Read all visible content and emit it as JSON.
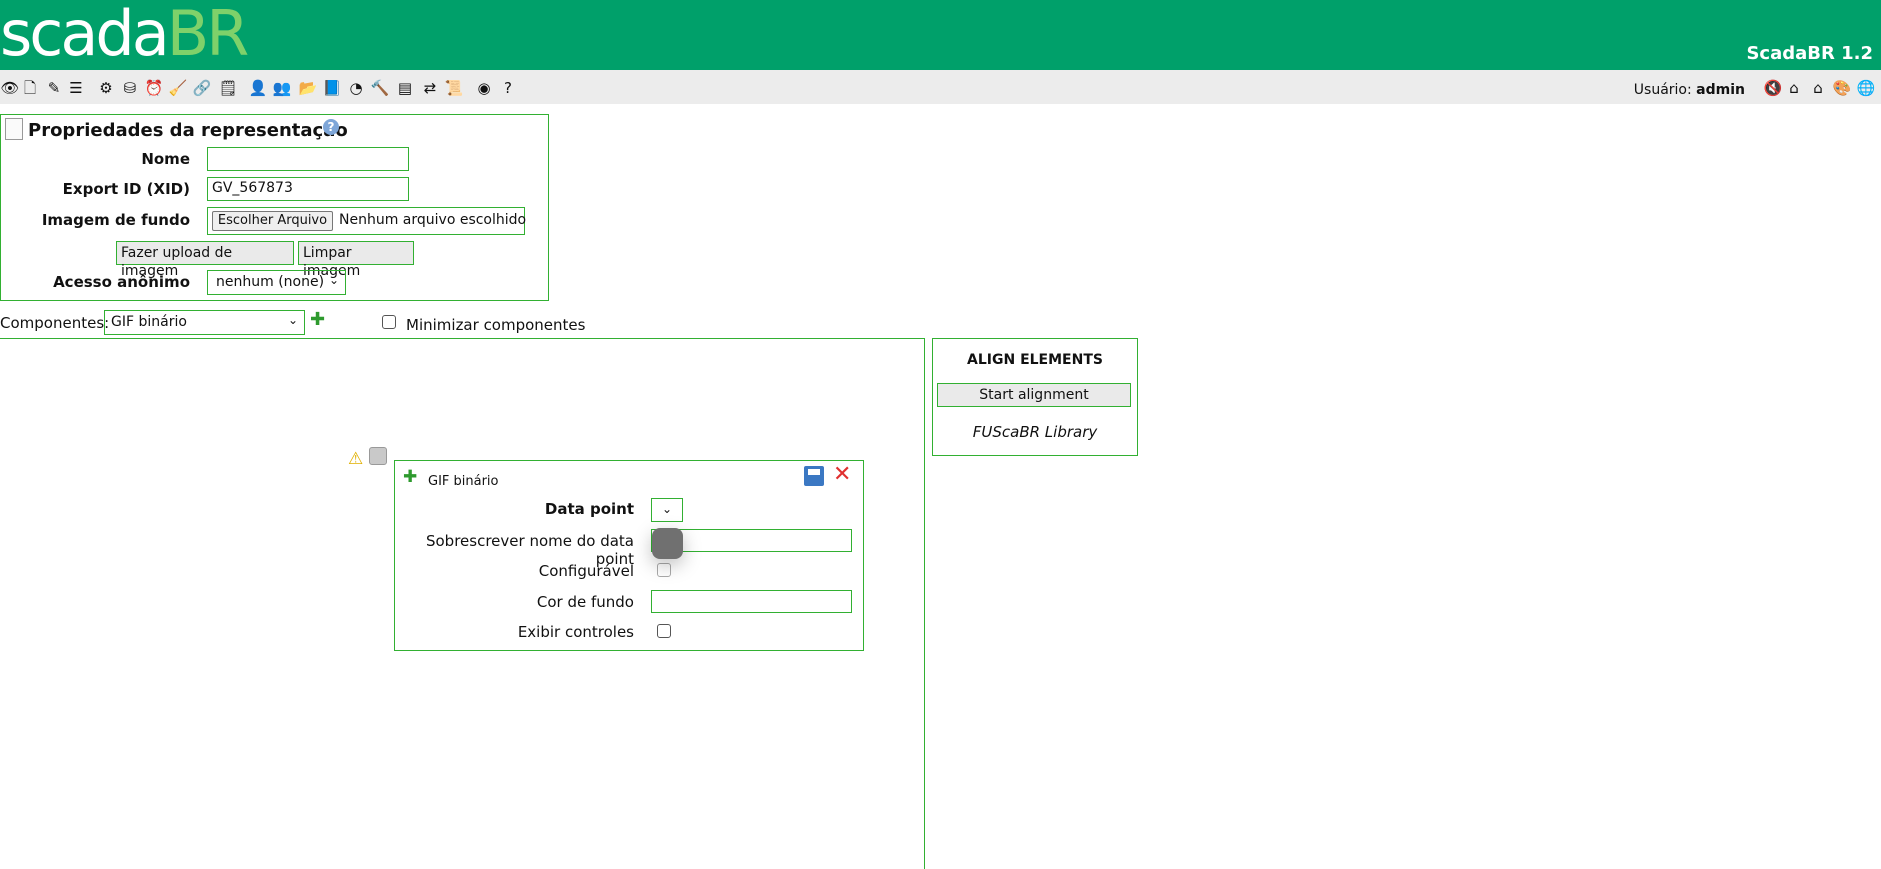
{
  "header": {
    "logo_main": "scada",
    "logo_accent": "BR",
    "version": "ScadaBR 1.2"
  },
  "toolbar": {
    "icons": [
      {
        "name": "eye-icon",
        "glyph": "👁"
      },
      {
        "name": "page-icon",
        "glyph": "🗋"
      },
      {
        "name": "notes-icon",
        "glyph": "✎"
      },
      {
        "name": "list-icon",
        "glyph": "☰"
      },
      {
        "name": "gear-icon",
        "glyph": "⚙"
      },
      {
        "name": "database-icon",
        "glyph": "⛁"
      },
      {
        "name": "clock-icon",
        "glyph": "⏰"
      },
      {
        "name": "broom-icon",
        "glyph": "🧹"
      },
      {
        "name": "link-icon",
        "glyph": "🔗"
      },
      {
        "name": "report-icon",
        "glyph": "🗒"
      },
      {
        "name": "user-icon",
        "glyph": "👤"
      },
      {
        "name": "users-icon",
        "glyph": "👥"
      },
      {
        "name": "folder-icon",
        "glyph": "📂"
      },
      {
        "name": "book-icon",
        "glyph": "📘"
      },
      {
        "name": "signal-icon",
        "glyph": "◔"
      },
      {
        "name": "tools-icon",
        "glyph": "🔨"
      },
      {
        "name": "window-icon",
        "glyph": "▤"
      },
      {
        "name": "import-export-icon",
        "glyph": "⇄"
      },
      {
        "name": "script-icon",
        "glyph": "📜"
      },
      {
        "name": "stop-icon",
        "glyph": "◉"
      },
      {
        "name": "help-icon",
        "glyph": "?"
      }
    ],
    "user_label": "Usuário:",
    "user_name": "admin",
    "right_icons": [
      {
        "name": "mute-icon",
        "glyph": "🔇"
      },
      {
        "name": "home-icon",
        "glyph": "⌂"
      },
      {
        "name": "home-set-icon",
        "glyph": "⌂"
      },
      {
        "name": "palette-icon",
        "glyph": "🎨"
      },
      {
        "name": "globe-icon",
        "glyph": "🌐"
      }
    ]
  },
  "props": {
    "title": "Propriedades da representação",
    "name_label": "Nome",
    "name_value": "",
    "xid_label": "Export ID (XID)",
    "xid_value": "GV_567873",
    "bg_label": "Imagem de fundo",
    "choose_file": "Escolher Arquivo",
    "no_file": "Nenhum arquivo escolhido",
    "upload_btn": "Fazer upload de imagem",
    "clear_btn": "Limpar imagem",
    "anon_label": "Acesso anônimo",
    "anon_value": "nenhum (none)"
  },
  "components": {
    "label": "Componentes:",
    "selected": "GIF binário",
    "minimize_label": "Minimizar componentes"
  },
  "align": {
    "title": "ALIGN ELEMENTS",
    "start_btn": "Start alignment",
    "library": "FUScaBR Library"
  },
  "editor": {
    "title": "GIF binário",
    "data_point_label": "Data point",
    "override_label": "Sobrescrever nome do data point",
    "configurable_label": "Configurável",
    "bg_color_label": "Cor de fundo",
    "show_controls_label": "Exibir controles"
  }
}
